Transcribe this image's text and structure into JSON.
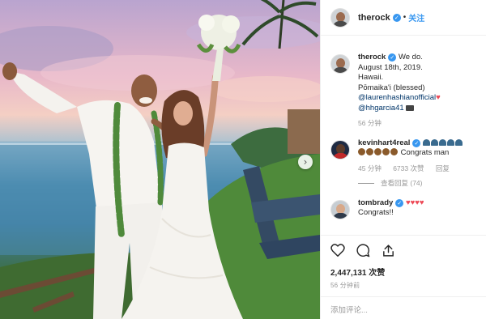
{
  "header": {
    "username": "therock",
    "verified_mark": "✓",
    "separator": "•",
    "follow_label": "关注"
  },
  "caption": {
    "username": "therock",
    "verified_mark": "✓",
    "lines": [
      "We do.",
      "August 18th, 2019.",
      "Hawaii.",
      "Pōmaika'i (blessed)"
    ],
    "mention_1": "@laurenhashianofficial",
    "heart_1": "♥",
    "mention_2": "@hhgarcia41",
    "time": "56 分钟"
  },
  "comments": [
    {
      "username": "kevinhart4real",
      "verified_mark": "✓",
      "text": "Congrats man",
      "time": "45 分钟",
      "likes": "6733 次赞",
      "reply": "回复",
      "view_replies": "查看回复 (74)",
      "icons": [
        "skull-emoji",
        "face-emoji"
      ]
    },
    {
      "username": "tombrady",
      "verified_mark": "✓",
      "hearts": "♥♥♥♥",
      "text": "Congrats!!",
      "icons": [
        "red-heart-emoji"
      ]
    }
  ],
  "actions": {
    "icons": [
      "heart-icon",
      "comment-icon",
      "share-icon"
    ],
    "likes_count": "2,447,131 次赞",
    "time": "56 分钟前"
  },
  "add_comment": {
    "placeholder": "添加评论..."
  },
  "colors": {
    "link_blue": "#3897f0",
    "mention_blue": "#003569",
    "heart_red": "#ed4956",
    "secondary_gray": "#999999"
  }
}
